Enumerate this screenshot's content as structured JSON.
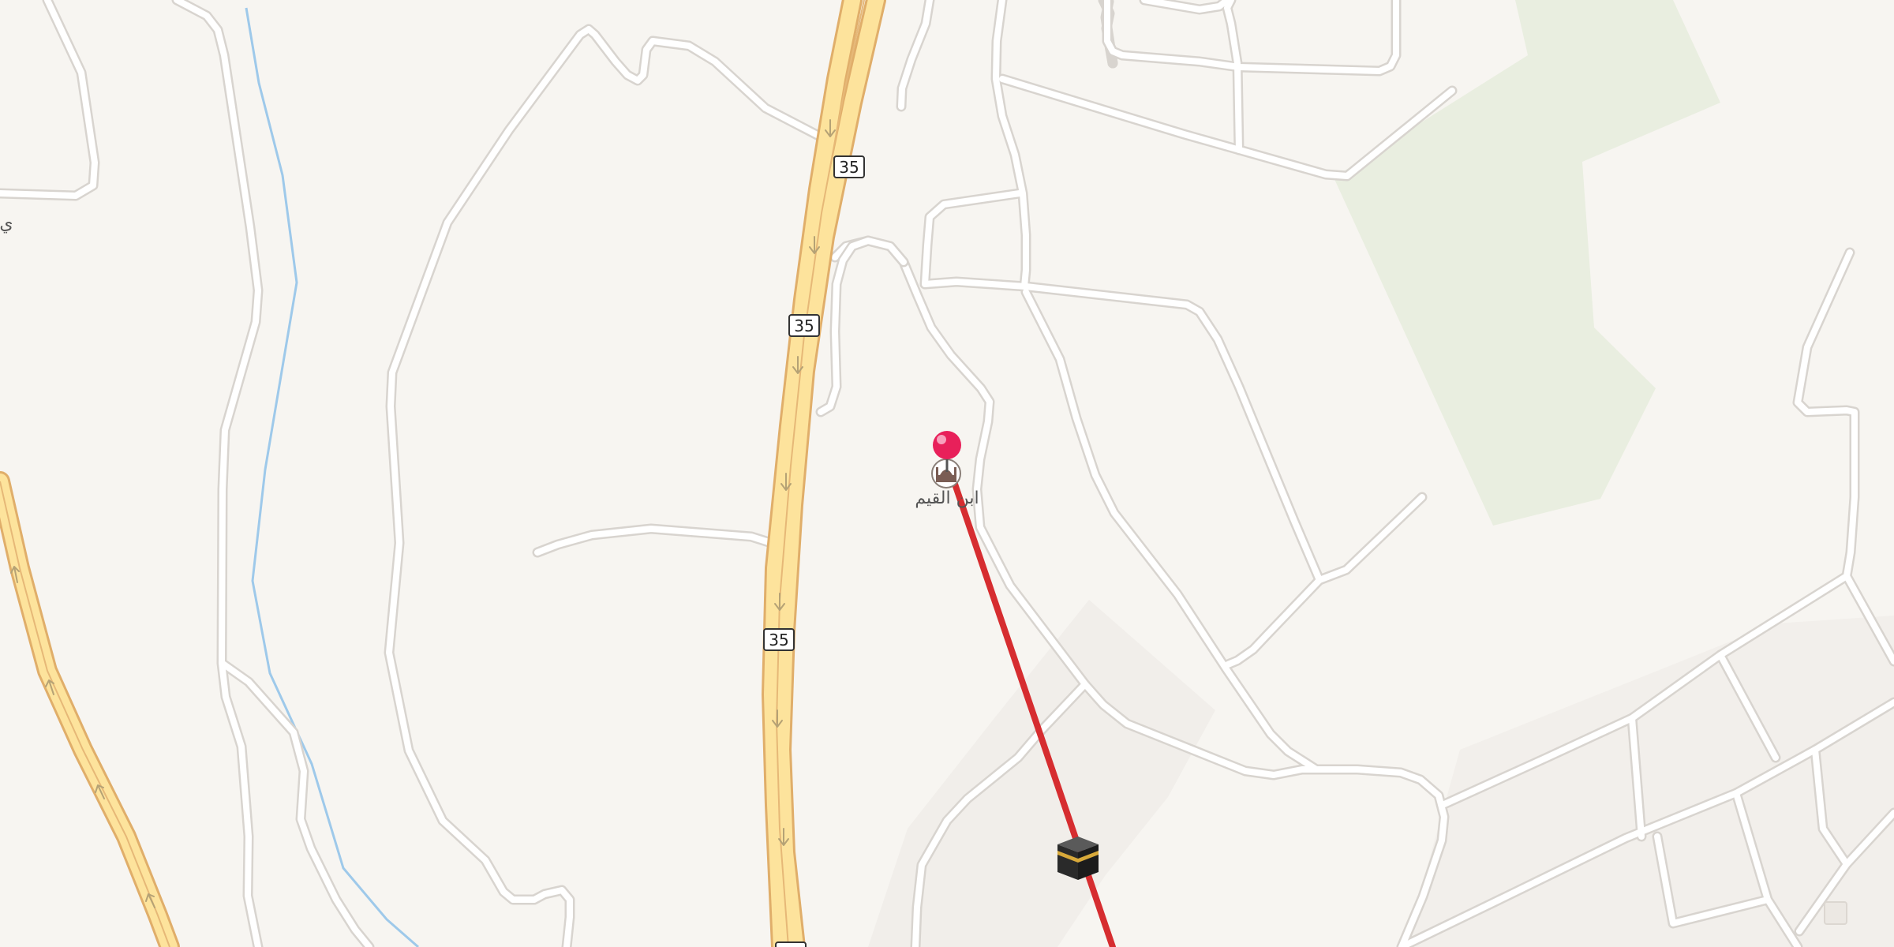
{
  "map": {
    "colors": {
      "background": "#f7f5f1",
      "park": "#e9eee0",
      "highway_fill": "#fde39c",
      "highway_casing": "#e0ae6a",
      "road": "#ffffff",
      "waterway": "#9ec9ea",
      "route_line": "#d62d30",
      "pin": "#e8205a"
    },
    "highway": {
      "route_number": "35"
    },
    "poi": {
      "label": "ابن القيم",
      "icon": "mosque-icon"
    },
    "destination": {
      "icon": "kaaba-icon"
    },
    "pin": {
      "icon": "map-pin-icon"
    },
    "edge_label": "ي"
  }
}
